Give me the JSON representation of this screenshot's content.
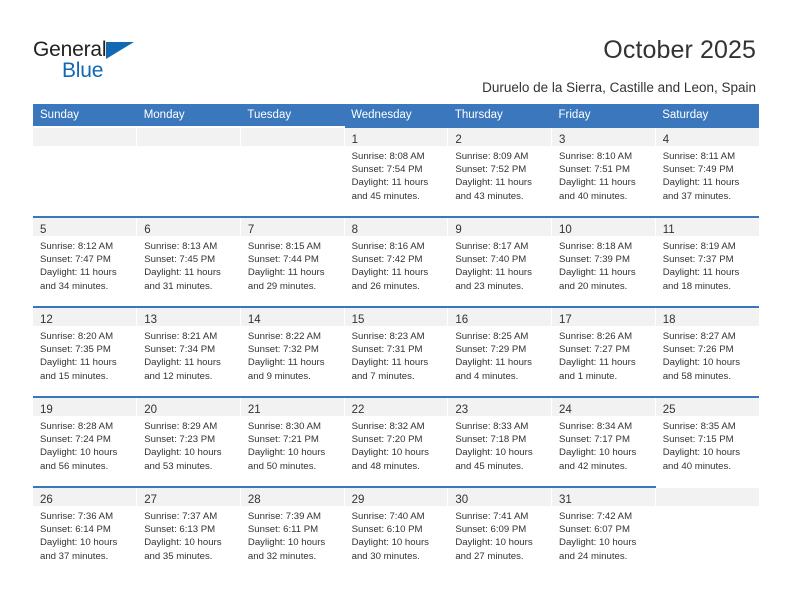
{
  "brand": {
    "name_part1": "General",
    "name_part2": "Blue",
    "triangle_color": "#1268b3",
    "text_color": "#231f20"
  },
  "header": {
    "title": "October 2025",
    "subtitle": "Duruelo de la Sierra, Castille and Leon, Spain"
  },
  "theme": {
    "header_blue": "#3a77bd",
    "daynum_band": "#f2f2f2",
    "text": "#333333"
  },
  "weekday_headers": [
    "Sunday",
    "Monday",
    "Tuesday",
    "Wednesday",
    "Thursday",
    "Friday",
    "Saturday"
  ],
  "weeks": [
    [
      {
        "day": "",
        "sunrise": "",
        "sunset": "",
        "daylight1": "",
        "daylight2": ""
      },
      {
        "day": "",
        "sunrise": "",
        "sunset": "",
        "daylight1": "",
        "daylight2": ""
      },
      {
        "day": "",
        "sunrise": "",
        "sunset": "",
        "daylight1": "",
        "daylight2": ""
      },
      {
        "day": "1",
        "sunrise": "Sunrise: 8:08 AM",
        "sunset": "Sunset: 7:54 PM",
        "daylight1": "Daylight: 11 hours",
        "daylight2": "and 45 minutes."
      },
      {
        "day": "2",
        "sunrise": "Sunrise: 8:09 AM",
        "sunset": "Sunset: 7:52 PM",
        "daylight1": "Daylight: 11 hours",
        "daylight2": "and 43 minutes."
      },
      {
        "day": "3",
        "sunrise": "Sunrise: 8:10 AM",
        "sunset": "Sunset: 7:51 PM",
        "daylight1": "Daylight: 11 hours",
        "daylight2": "and 40 minutes."
      },
      {
        "day": "4",
        "sunrise": "Sunrise: 8:11 AM",
        "sunset": "Sunset: 7:49 PM",
        "daylight1": "Daylight: 11 hours",
        "daylight2": "and 37 minutes."
      }
    ],
    [
      {
        "day": "5",
        "sunrise": "Sunrise: 8:12 AM",
        "sunset": "Sunset: 7:47 PM",
        "daylight1": "Daylight: 11 hours",
        "daylight2": "and 34 minutes."
      },
      {
        "day": "6",
        "sunrise": "Sunrise: 8:13 AM",
        "sunset": "Sunset: 7:45 PM",
        "daylight1": "Daylight: 11 hours",
        "daylight2": "and 31 minutes."
      },
      {
        "day": "7",
        "sunrise": "Sunrise: 8:15 AM",
        "sunset": "Sunset: 7:44 PM",
        "daylight1": "Daylight: 11 hours",
        "daylight2": "and 29 minutes."
      },
      {
        "day": "8",
        "sunrise": "Sunrise: 8:16 AM",
        "sunset": "Sunset: 7:42 PM",
        "daylight1": "Daylight: 11 hours",
        "daylight2": "and 26 minutes."
      },
      {
        "day": "9",
        "sunrise": "Sunrise: 8:17 AM",
        "sunset": "Sunset: 7:40 PM",
        "daylight1": "Daylight: 11 hours",
        "daylight2": "and 23 minutes."
      },
      {
        "day": "10",
        "sunrise": "Sunrise: 8:18 AM",
        "sunset": "Sunset: 7:39 PM",
        "daylight1": "Daylight: 11 hours",
        "daylight2": "and 20 minutes."
      },
      {
        "day": "11",
        "sunrise": "Sunrise: 8:19 AM",
        "sunset": "Sunset: 7:37 PM",
        "daylight1": "Daylight: 11 hours",
        "daylight2": "and 18 minutes."
      }
    ],
    [
      {
        "day": "12",
        "sunrise": "Sunrise: 8:20 AM",
        "sunset": "Sunset: 7:35 PM",
        "daylight1": "Daylight: 11 hours",
        "daylight2": "and 15 minutes."
      },
      {
        "day": "13",
        "sunrise": "Sunrise: 8:21 AM",
        "sunset": "Sunset: 7:34 PM",
        "daylight1": "Daylight: 11 hours",
        "daylight2": "and 12 minutes."
      },
      {
        "day": "14",
        "sunrise": "Sunrise: 8:22 AM",
        "sunset": "Sunset: 7:32 PM",
        "daylight1": "Daylight: 11 hours",
        "daylight2": "and 9 minutes."
      },
      {
        "day": "15",
        "sunrise": "Sunrise: 8:23 AM",
        "sunset": "Sunset: 7:31 PM",
        "daylight1": "Daylight: 11 hours",
        "daylight2": "and 7 minutes."
      },
      {
        "day": "16",
        "sunrise": "Sunrise: 8:25 AM",
        "sunset": "Sunset: 7:29 PM",
        "daylight1": "Daylight: 11 hours",
        "daylight2": "and 4 minutes."
      },
      {
        "day": "17",
        "sunrise": "Sunrise: 8:26 AM",
        "sunset": "Sunset: 7:27 PM",
        "daylight1": "Daylight: 11 hours",
        "daylight2": "and 1 minute."
      },
      {
        "day": "18",
        "sunrise": "Sunrise: 8:27 AM",
        "sunset": "Sunset: 7:26 PM",
        "daylight1": "Daylight: 10 hours",
        "daylight2": "and 58 minutes."
      }
    ],
    [
      {
        "day": "19",
        "sunrise": "Sunrise: 8:28 AM",
        "sunset": "Sunset: 7:24 PM",
        "daylight1": "Daylight: 10 hours",
        "daylight2": "and 56 minutes."
      },
      {
        "day": "20",
        "sunrise": "Sunrise: 8:29 AM",
        "sunset": "Sunset: 7:23 PM",
        "daylight1": "Daylight: 10 hours",
        "daylight2": "and 53 minutes."
      },
      {
        "day": "21",
        "sunrise": "Sunrise: 8:30 AM",
        "sunset": "Sunset: 7:21 PM",
        "daylight1": "Daylight: 10 hours",
        "daylight2": "and 50 minutes."
      },
      {
        "day": "22",
        "sunrise": "Sunrise: 8:32 AM",
        "sunset": "Sunset: 7:20 PM",
        "daylight1": "Daylight: 10 hours",
        "daylight2": "and 48 minutes."
      },
      {
        "day": "23",
        "sunrise": "Sunrise: 8:33 AM",
        "sunset": "Sunset: 7:18 PM",
        "daylight1": "Daylight: 10 hours",
        "daylight2": "and 45 minutes."
      },
      {
        "day": "24",
        "sunrise": "Sunrise: 8:34 AM",
        "sunset": "Sunset: 7:17 PM",
        "daylight1": "Daylight: 10 hours",
        "daylight2": "and 42 minutes."
      },
      {
        "day": "25",
        "sunrise": "Sunrise: 8:35 AM",
        "sunset": "Sunset: 7:15 PM",
        "daylight1": "Daylight: 10 hours",
        "daylight2": "and 40 minutes."
      }
    ],
    [
      {
        "day": "26",
        "sunrise": "Sunrise: 7:36 AM",
        "sunset": "Sunset: 6:14 PM",
        "daylight1": "Daylight: 10 hours",
        "daylight2": "and 37 minutes."
      },
      {
        "day": "27",
        "sunrise": "Sunrise: 7:37 AM",
        "sunset": "Sunset: 6:13 PM",
        "daylight1": "Daylight: 10 hours",
        "daylight2": "and 35 minutes."
      },
      {
        "day": "28",
        "sunrise": "Sunrise: 7:39 AM",
        "sunset": "Sunset: 6:11 PM",
        "daylight1": "Daylight: 10 hours",
        "daylight2": "and 32 minutes."
      },
      {
        "day": "29",
        "sunrise": "Sunrise: 7:40 AM",
        "sunset": "Sunset: 6:10 PM",
        "daylight1": "Daylight: 10 hours",
        "daylight2": "and 30 minutes."
      },
      {
        "day": "30",
        "sunrise": "Sunrise: 7:41 AM",
        "sunset": "Sunset: 6:09 PM",
        "daylight1": "Daylight: 10 hours",
        "daylight2": "and 27 minutes."
      },
      {
        "day": "31",
        "sunrise": "Sunrise: 7:42 AM",
        "sunset": "Sunset: 6:07 PM",
        "daylight1": "Daylight: 10 hours",
        "daylight2": "and 24 minutes."
      },
      {
        "day": "",
        "sunrise": "",
        "sunset": "",
        "daylight1": "",
        "daylight2": ""
      }
    ]
  ]
}
